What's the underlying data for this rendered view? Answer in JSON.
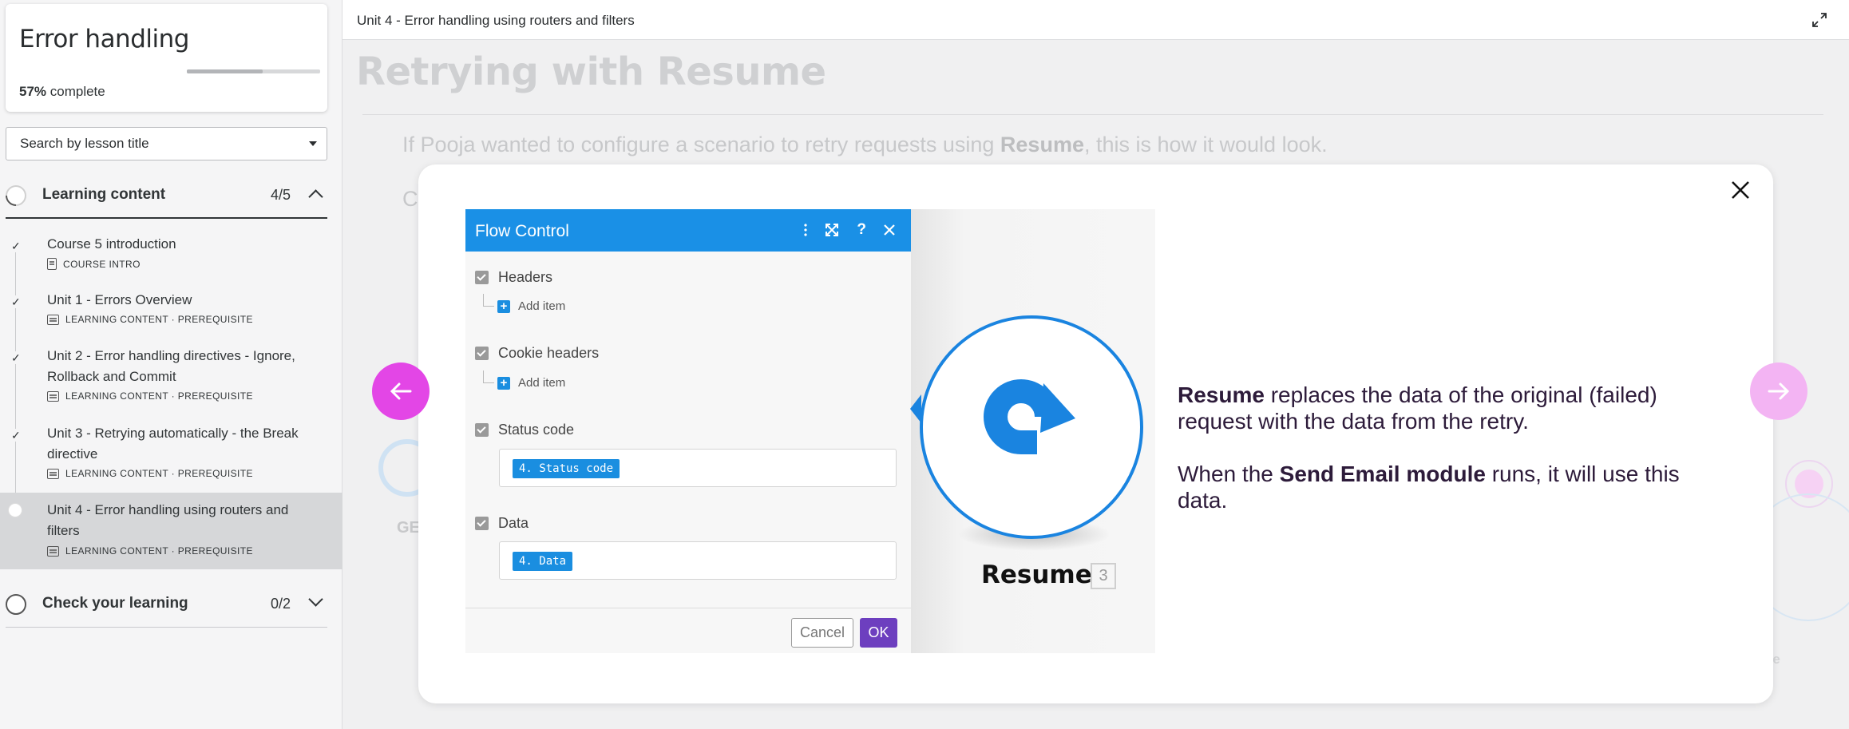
{
  "sidebar": {
    "course_title": "Error handling",
    "progress_percent": 57,
    "progress_value": "57%",
    "progress_suffix": " complete",
    "search_placeholder": "Search by lesson title",
    "sections": [
      {
        "label": "Learning content",
        "count": "4/5",
        "expanded": true
      },
      {
        "label": "Check your learning",
        "count": "0/2",
        "expanded": false
      }
    ],
    "lessons": [
      {
        "title": "Course 5 introduction",
        "meta": "COURSE INTRO",
        "done": true
      },
      {
        "title": "Unit 1 - Errors Overview",
        "meta": "LEARNING CONTENT · PREREQUISITE",
        "done": true
      },
      {
        "title": "Unit 2 - Error handling directives - Ignore, Rollback and Commit",
        "meta": "LEARNING CONTENT · PREREQUISITE",
        "done": true
      },
      {
        "title": "Unit 3 - Retrying automatically - the Break directive",
        "meta": "LEARNING CONTENT · PREREQUISITE",
        "done": true
      },
      {
        "title": "Unit 4 - Error handling using routers and filters",
        "meta": "LEARNING CONTENT · PREREQUISITE",
        "done": false,
        "current": true
      }
    ]
  },
  "main": {
    "unit_title": "Unit 4 - Error handling using routers and filters",
    "heading": "Retrying with Resume",
    "para_before": "If Pooja wanted to configure a scenario to retry requests using ",
    "para_bold": "Resume",
    "para_after": ", this is how it would look.",
    "bg_c": "C",
    "bg_ge": "GE",
    "bg_me": "ne"
  },
  "modal": {
    "dialog": {
      "title": "Flow Control",
      "headers_label": "Headers",
      "add_item": "Add item",
      "cookie_label": "Cookie headers",
      "status_label": "Status code",
      "status_pill": "4. Status code",
      "data_label": "Data",
      "data_pill": "4. Data",
      "cancel": "Cancel",
      "ok": "OK"
    },
    "module_label": "Resume",
    "module_number": "3",
    "text": {
      "p1_bold": "Resume",
      "p1_rest": " replaces the data of the original (failed) request with the data from the retry.",
      "p2_before": "When the ",
      "p2_bold": "Send Email module",
      "p2_after": " runs, it will use this data."
    }
  },
  "colors": {
    "nav_prev": "#e346e6",
    "nav_next": "#f3b4f3",
    "dialog_header": "#1a90e6",
    "ok_button": "#6d3fbf",
    "resume_blue": "#1a84e0"
  },
  "icons": [
    "check-icon",
    "caret-down-icon",
    "chevron-up-icon",
    "chevron-down-icon",
    "expand-icon",
    "close-icon",
    "arrow-left-icon",
    "arrow-right-icon",
    "resume-arrow-icon"
  ]
}
